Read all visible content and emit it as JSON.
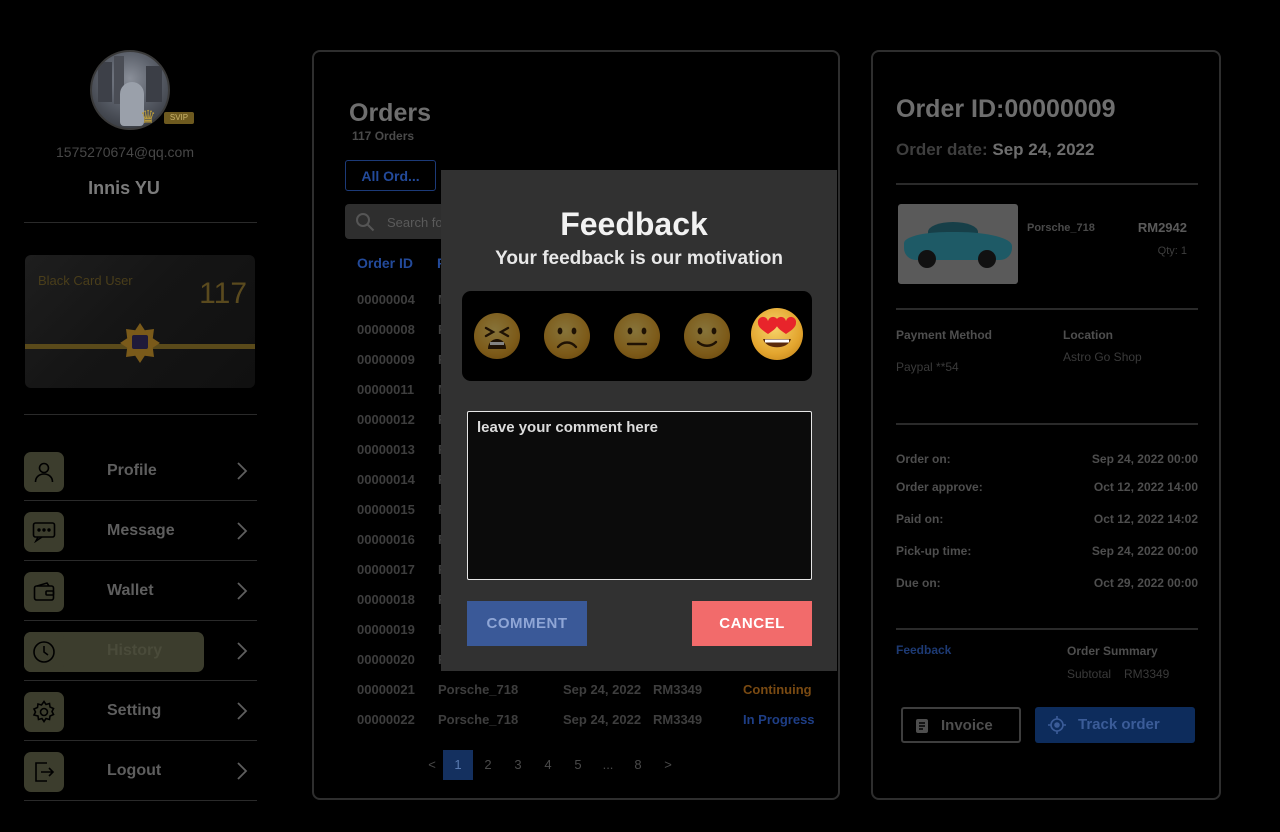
{
  "user": {
    "email": "1575270674@qq.com",
    "name": "Innis YU",
    "badge": "SVIP",
    "card": {
      "label": "Black Card User",
      "number": "117"
    }
  },
  "menu": [
    {
      "label": "Profile",
      "icon": "user-icon",
      "active": false
    },
    {
      "label": "Message",
      "icon": "message-icon",
      "active": false
    },
    {
      "label": "Wallet",
      "icon": "wallet-icon",
      "active": false
    },
    {
      "label": "History",
      "icon": "clock-icon",
      "active": true
    },
    {
      "label": "Setting",
      "icon": "gear-icon",
      "active": false
    },
    {
      "label": "Logout",
      "icon": "logout-icon",
      "active": false
    }
  ],
  "orders": {
    "title": "Orders",
    "count": "117 Orders",
    "tab_all": "All Ord...",
    "search_placeholder": "Search fo",
    "col_id": "Order ID",
    "col_f": "F",
    "rows": [
      {
        "id": "00000004",
        "p": "M",
        "date": "",
        "price": "",
        "status": ""
      },
      {
        "id": "00000008",
        "p": "F",
        "date": "",
        "price": "",
        "status": ""
      },
      {
        "id": "00000009",
        "p": "F",
        "date": "",
        "price": "",
        "status": ""
      },
      {
        "id": "00000011",
        "p": "M",
        "date": "",
        "price": "",
        "status": ""
      },
      {
        "id": "00000012",
        "p": "F",
        "date": "",
        "price": "",
        "status": ""
      },
      {
        "id": "00000013",
        "p": "F",
        "date": "",
        "price": "",
        "status": ""
      },
      {
        "id": "00000014",
        "p": "F",
        "date": "",
        "price": "",
        "status": ""
      },
      {
        "id": "00000015",
        "p": "F",
        "date": "",
        "price": "",
        "status": ""
      },
      {
        "id": "00000016",
        "p": "F",
        "date": "",
        "price": "",
        "status": ""
      },
      {
        "id": "00000017",
        "p": "F",
        "date": "",
        "price": "",
        "status": ""
      },
      {
        "id": "00000018",
        "p": "F",
        "date": "",
        "price": "",
        "status": ""
      },
      {
        "id": "00000019",
        "p": "F",
        "date": "",
        "price": "",
        "status": ""
      },
      {
        "id": "00000020",
        "p": "F",
        "date": "",
        "price": "",
        "status": ""
      },
      {
        "id": "00000021",
        "p": "Porsche_718",
        "date": "Sep 24, 2022",
        "price": "RM3349",
        "status": "Continuing"
      },
      {
        "id": "00000022",
        "p": "Porsche_718",
        "date": "Sep 24, 2022",
        "price": "RM3349",
        "status": "In Progress"
      }
    ],
    "pager": [
      "<",
      "1",
      "2",
      "3",
      "4",
      "5",
      "...",
      "8",
      ">"
    ],
    "current_page": "1"
  },
  "detail": {
    "title": "Order ID:00000009",
    "date_label": "Order date:",
    "date_value": "Sep 24, 2022",
    "product": {
      "name": "Porsche_718",
      "price": "RM2942",
      "qty": "Qty: 1"
    },
    "payment_label": "Payment Method",
    "payment_value": "Paypal **54",
    "location_label": "Location",
    "location_value": "Astro Go Shop",
    "timeline": [
      {
        "k": "Order on:",
        "v": "Sep 24, 2022 00:00"
      },
      {
        "k": "Order approve:",
        "v": "Oct 12, 2022 14:00"
      },
      {
        "k": "Paid on:",
        "v": "Oct 12, 2022 14:02"
      },
      {
        "k": "Pick-up time:",
        "v": "Sep 24, 2022 00:00"
      },
      {
        "k": "Due on:",
        "v": "Oct 29, 2022 00:00"
      }
    ],
    "feedback_link": "Feedback",
    "summary_label": "Order Summary",
    "subtotal_label": "Subtotal",
    "subtotal_value": "RM3349",
    "invoice_btn": "Invoice",
    "track_btn": "Track order"
  },
  "modal": {
    "title": "Feedback",
    "subtitle": "Your feedback is our motivation",
    "emojis": [
      "tired-face-icon",
      "frowning-face-icon",
      "neutral-face-icon",
      "slightly-smiling-face-icon",
      "heart-eyes-face-icon"
    ],
    "comment_value": "leave your comment here",
    "comment_btn": "COMMENT",
    "cancel_btn": "CANCEL"
  },
  "colors": {
    "accent_blue": "#3a5998",
    "cancel_red": "#f26b6b",
    "modal_bg": "#313131",
    "status_continuing": "#7a4a12",
    "status_in_progress": "#1e3e86"
  }
}
